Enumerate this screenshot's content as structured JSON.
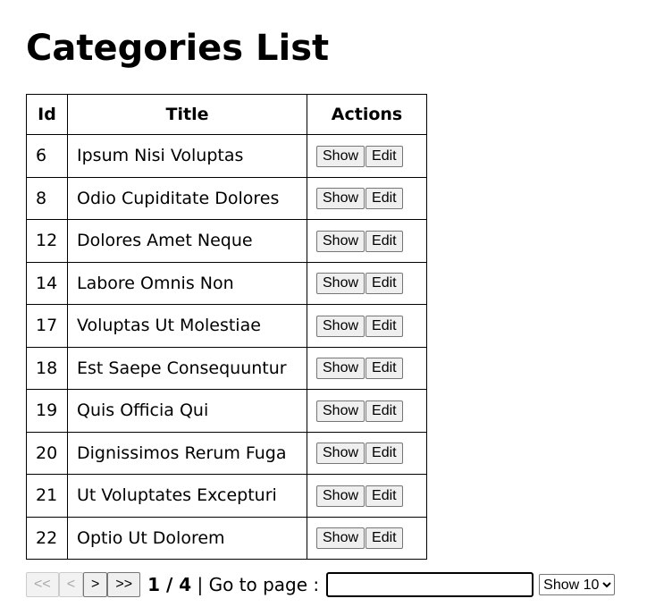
{
  "page_title": "Categories List",
  "table": {
    "headers": [
      "Id",
      "Title",
      "Actions"
    ],
    "show_label": "Show",
    "edit_label": "Edit",
    "rows": [
      {
        "id": "6",
        "title": "Ipsum Nisi Voluptas"
      },
      {
        "id": "8",
        "title": "Odio Cupiditate Dolores"
      },
      {
        "id": "12",
        "title": "Dolores Amet Neque"
      },
      {
        "id": "14",
        "title": "Labore Omnis Non"
      },
      {
        "id": "17",
        "title": "Voluptas Ut Molestiae"
      },
      {
        "id": "18",
        "title": "Est Saepe Consequuntur"
      },
      {
        "id": "19",
        "title": "Quis Officia Qui"
      },
      {
        "id": "20",
        "title": "Dignissimos Rerum Fuga"
      },
      {
        "id": "21",
        "title": "Ut Voluptates Excepturi"
      },
      {
        "id": "22",
        "title": "Optio Ut Dolorem"
      }
    ]
  },
  "pager": {
    "first": "<<",
    "prev": "<",
    "next": ">",
    "last": ">>",
    "current": "1 / 4",
    "goto_label": "| Go to page :",
    "goto_value": "",
    "page_size": "Show 10"
  }
}
